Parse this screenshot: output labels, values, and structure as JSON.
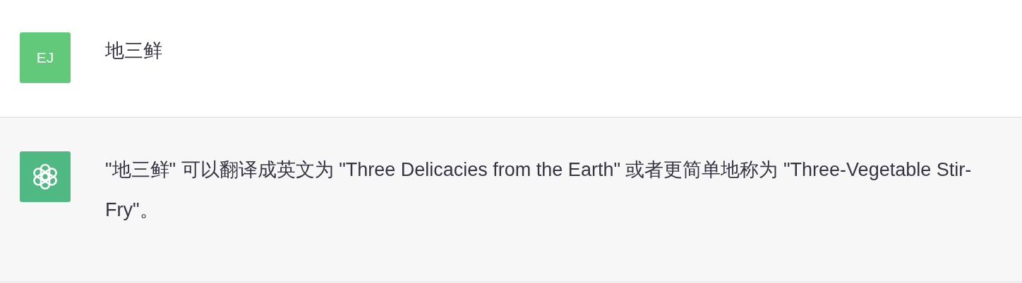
{
  "messages": [
    {
      "kind": "user",
      "avatar": "EJ",
      "text": "地三鲜"
    },
    {
      "kind": "assistant",
      "text": "\"地三鲜\" 可以翻译成英文为 \"Three Delicacies from the Earth\" 或者更简单地称为 \"Three-Vegetable Stir-Fry\"。"
    }
  ]
}
